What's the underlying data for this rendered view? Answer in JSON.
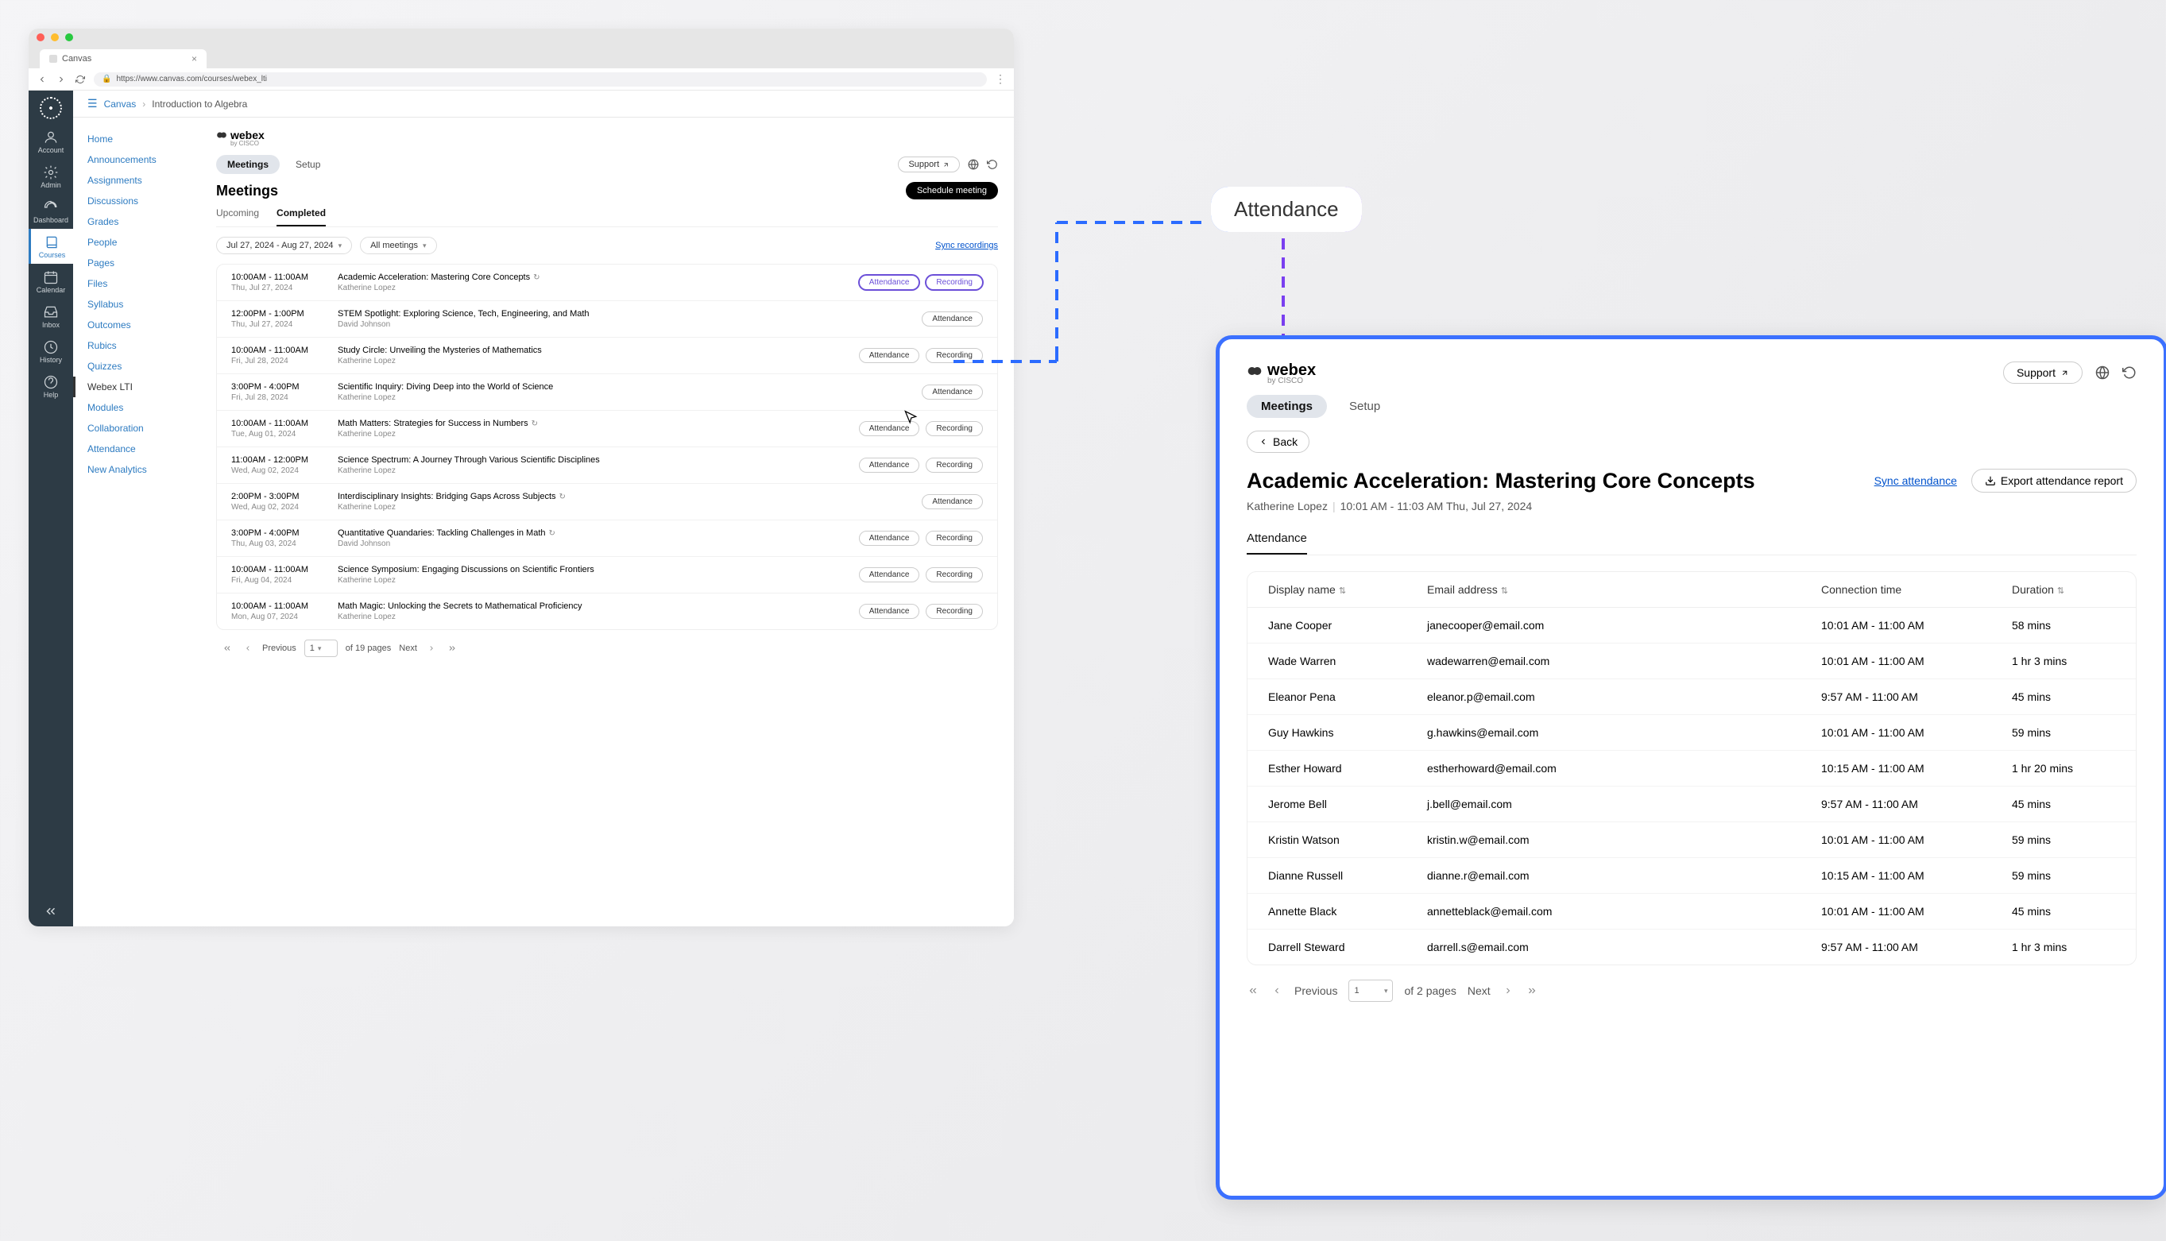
{
  "browser": {
    "tab_title": "Canvas",
    "url": "https://www.canvas.com/courses/webex_lti"
  },
  "canvas_rail": [
    {
      "label": "Account",
      "icon": "user"
    },
    {
      "label": "Admin",
      "icon": "admin"
    },
    {
      "label": "Dashboard",
      "icon": "dash"
    },
    {
      "label": "Courses",
      "icon": "book",
      "active": true
    },
    {
      "label": "Calendar",
      "icon": "cal"
    },
    {
      "label": "Inbox",
      "icon": "inbox"
    },
    {
      "label": "History",
      "icon": "history"
    },
    {
      "label": "Help",
      "icon": "help"
    }
  ],
  "breadcrumb": {
    "root": "Canvas",
    "current": "Introduction to Algebra"
  },
  "course_nav": [
    "Home",
    "Announcements",
    "Assignments",
    "Discussions",
    "Grades",
    "People",
    "Pages",
    "Files",
    "Syllabus",
    "Outcomes",
    "Rubics",
    "Quizzes",
    "Webex LTI",
    "Modules",
    "Collaboration",
    "Attendance",
    "New Analytics"
  ],
  "course_nav_active": "Webex LTI",
  "webex": {
    "brand": "webex",
    "brand_sub": "by CISCO",
    "tabs": {
      "meetings": "Meetings",
      "setup": "Setup"
    },
    "support": "Support",
    "title": "Meetings",
    "schedule": "Schedule meeting",
    "subtabs": {
      "upcoming": "Upcoming",
      "completed": "Completed"
    },
    "date_filter": "Jul 27, 2024 - Aug 27, 2024",
    "type_filter": "All meetings",
    "sync": "Sync recordings",
    "btn_attendance": "Attendance",
    "btn_recording": "Recording",
    "pagination": {
      "previous": "Previous",
      "next": "Next",
      "page": "1",
      "total": "of 19 pages"
    }
  },
  "meetings": [
    {
      "time": "10:00AM - 11:00AM",
      "date": "Thu, Jul 27, 2024",
      "title": "Academic Acceleration: Mastering Core Concepts",
      "host": "Katherine Lopez",
      "recurring": true,
      "recording": true,
      "highlight": true
    },
    {
      "time": "12:00PM - 1:00PM",
      "date": "Thu, Jul 27, 2024",
      "title": "STEM Spotlight: Exploring Science, Tech, Engineering, and Math",
      "host": "David Johnson",
      "recurring": false,
      "recording": false
    },
    {
      "time": "10:00AM - 11:00AM",
      "date": "Fri, Jul 28, 2024",
      "title": "Study Circle: Unveiling the Mysteries of Mathematics",
      "host": "Katherine Lopez",
      "recurring": false,
      "recording": true
    },
    {
      "time": "3:00PM - 4:00PM",
      "date": "Fri, Jul 28, 2024",
      "title": "Scientific Inquiry: Diving Deep into the World of Science",
      "host": "Katherine Lopez",
      "recurring": false,
      "recording": false
    },
    {
      "time": "10:00AM - 11:00AM",
      "date": "Tue, Aug 01, 2024",
      "title": "Math Matters: Strategies for Success in Numbers",
      "host": "Katherine Lopez",
      "recurring": true,
      "recording": true
    },
    {
      "time": "11:00AM - 12:00PM",
      "date": "Wed, Aug 02, 2024",
      "title": "Science Spectrum: A Journey Through Various Scientific Disciplines",
      "host": "Katherine Lopez",
      "recurring": false,
      "recording": true
    },
    {
      "time": "2:00PM - 3:00PM",
      "date": "Wed, Aug 02, 2024",
      "title": "Interdisciplinary Insights: Bridging Gaps Across Subjects",
      "host": "Katherine Lopez",
      "recurring": true,
      "recording": false
    },
    {
      "time": "3:00PM - 4:00PM",
      "date": "Thu, Aug 03, 2024",
      "title": "Quantitative Quandaries: Tackling Challenges in Math",
      "host": "David Johnson",
      "recurring": true,
      "recording": true
    },
    {
      "time": "10:00AM - 11:00AM",
      "date": "Fri, Aug 04, 2024",
      "title": "Science Symposium: Engaging Discussions on Scientific Frontiers",
      "host": "Katherine Lopez",
      "recurring": false,
      "recording": true
    },
    {
      "time": "10:00AM - 11:00AM",
      "date": "Mon, Aug 07, 2024",
      "title": "Math Magic: Unlocking the Secrets to Mathematical Proficiency",
      "host": "Katherine Lopez",
      "recurring": false,
      "recording": true
    }
  ],
  "callout_label": "Attendance",
  "detail": {
    "brand": "webex",
    "brand_sub": "by CISCO",
    "tabs": {
      "meetings": "Meetings",
      "setup": "Setup"
    },
    "support": "Support",
    "back": "Back",
    "title": "Academic Acceleration: Mastering Core Concepts",
    "host": "Katherine Lopez",
    "timerange": "10:01 AM - 11:03 AM Thu, Jul 27, 2024",
    "sync": "Sync attendance",
    "export": "Export attendance report",
    "subtab": "Attendance",
    "columns": {
      "name": "Display name",
      "email": "Email address",
      "conn": "Connection time",
      "dur": "Duration"
    },
    "rows": [
      {
        "name": "Jane Cooper",
        "email": "janecooper@email.com",
        "conn": "10:01 AM - 11:00 AM",
        "dur": "58 mins"
      },
      {
        "name": "Wade Warren",
        "email": "wadewarren@email.com",
        "conn": "10:01 AM - 11:00 AM",
        "dur": "1 hr 3 mins"
      },
      {
        "name": "Eleanor Pena",
        "email": "eleanor.p@email.com",
        "conn": "9:57 AM - 11:00 AM",
        "dur": "45 mins"
      },
      {
        "name": "Guy Hawkins",
        "email": "g.hawkins@email.com",
        "conn": "10:01 AM - 11:00 AM",
        "dur": "59 mins"
      },
      {
        "name": "Esther Howard",
        "email": "estherhoward@email.com",
        "conn": "10:15 AM - 11:00 AM",
        "dur": "1 hr 20 mins"
      },
      {
        "name": "Jerome Bell",
        "email": "j.bell@email.com",
        "conn": "9:57 AM - 11:00 AM",
        "dur": "45 mins"
      },
      {
        "name": "Kristin Watson",
        "email": "kristin.w@email.com",
        "conn": "10:01 AM - 11:00 AM",
        "dur": "59 mins"
      },
      {
        "name": "Dianne Russell",
        "email": "dianne.r@email.com",
        "conn": "10:15 AM - 11:00 AM",
        "dur": "59 mins"
      },
      {
        "name": "Annette Black",
        "email": "annetteblack@email.com",
        "conn": "10:01 AM - 11:00 AM",
        "dur": "45 mins"
      },
      {
        "name": "Darrell Steward",
        "email": "darrell.s@email.com",
        "conn": "9:57 AM - 11:00 AM",
        "dur": "1 hr 3 mins"
      }
    ],
    "pagination": {
      "previous": "Previous",
      "next": "Next",
      "page": "1",
      "total": "of 2 pages"
    }
  }
}
